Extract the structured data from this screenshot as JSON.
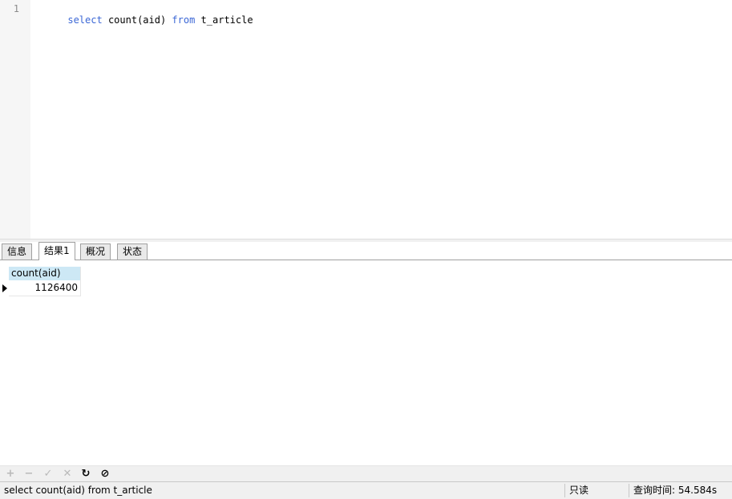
{
  "editor": {
    "line_number": "1",
    "tokens": [
      {
        "text": "select",
        "kind": "keyword"
      },
      {
        "text": " count(aid) ",
        "kind": "text"
      },
      {
        "text": "from",
        "kind": "keyword"
      },
      {
        "text": " t_article",
        "kind": "text"
      }
    ],
    "keyword_color": "#3b67d6"
  },
  "tabs": [
    {
      "label": "信息",
      "active": false
    },
    {
      "label": "结果1",
      "active": true
    },
    {
      "label": "概况",
      "active": false
    },
    {
      "label": "状态",
      "active": false
    }
  ],
  "grid": {
    "columns": [
      "count(aid)"
    ],
    "rows": [
      [
        "1126400"
      ]
    ],
    "header_color": "#cde8f5"
  },
  "toolbar": {
    "buttons": [
      {
        "icon": "plus-icon",
        "glyph": "+",
        "enabled": false
      },
      {
        "icon": "minus-icon",
        "glyph": "−",
        "enabled": false
      },
      {
        "icon": "check-icon",
        "glyph": "✓",
        "enabled": false
      },
      {
        "icon": "cross-icon",
        "glyph": "✕",
        "enabled": false
      },
      {
        "icon": "refresh-icon",
        "glyph": "↻",
        "enabled": true
      },
      {
        "icon": "stop-icon",
        "glyph": "⊘",
        "enabled": true
      }
    ]
  },
  "statusbar": {
    "sql": "select count(aid) from t_article",
    "readonly": "只读",
    "query_time": "查询时间: 54.584s"
  }
}
